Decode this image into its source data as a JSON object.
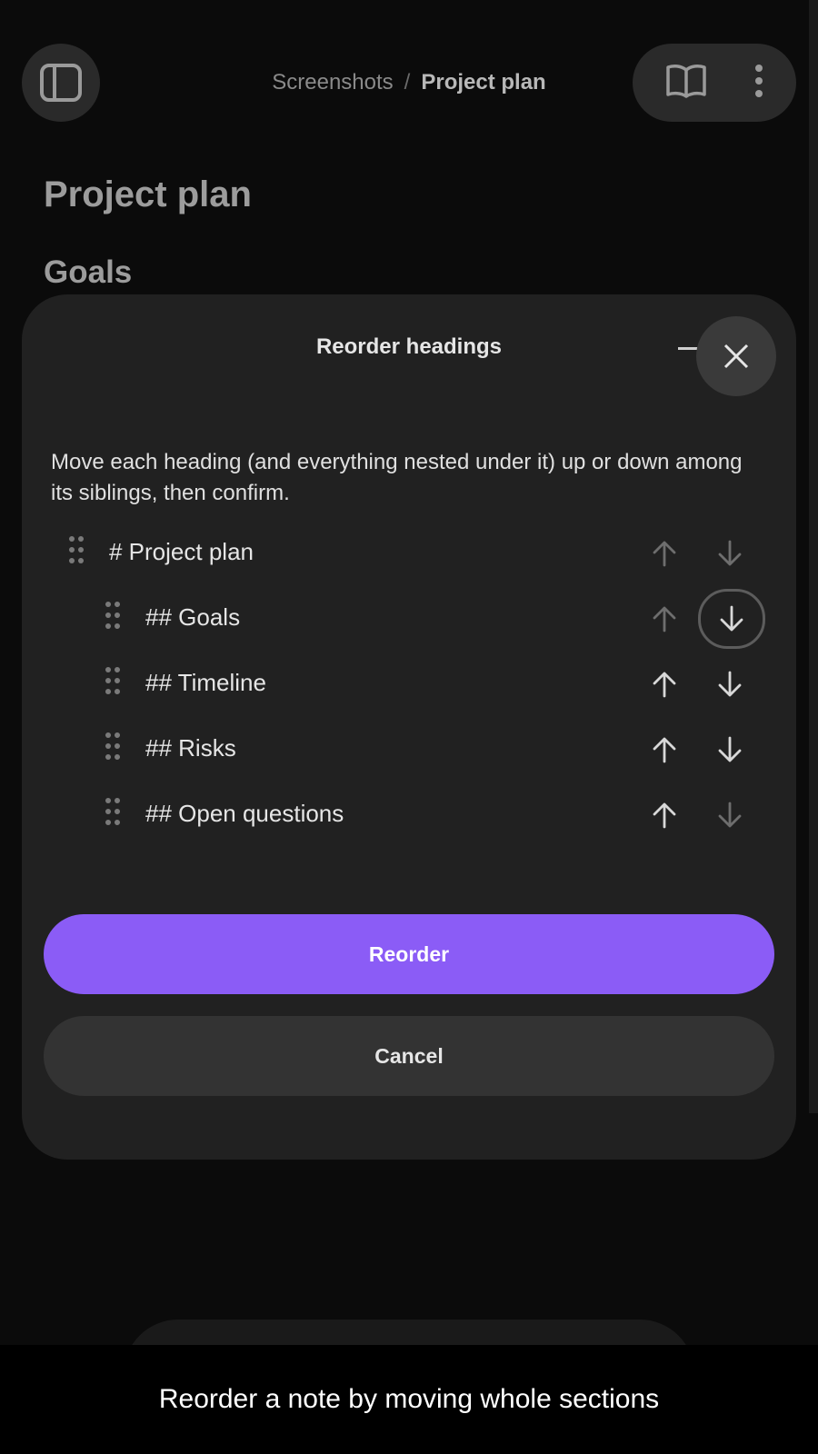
{
  "header": {
    "breadcrumb_root": "Screenshots",
    "breadcrumb_separator": "/",
    "breadcrumb_current": "Project plan"
  },
  "note": {
    "title": "Project plan",
    "first_heading": "Goals"
  },
  "dialog": {
    "title": "Reorder headings",
    "description": "Move each heading (and everything nested under it) up or down among its siblings, then confirm.",
    "headings": [
      {
        "label": "# Project plan",
        "level": 1,
        "up_enabled": false,
        "down_enabled": false
      },
      {
        "label": "## Goals",
        "level": 2,
        "up_enabled": false,
        "down_enabled": true,
        "down_focused": true
      },
      {
        "label": "## Timeline",
        "level": 2,
        "up_enabled": true,
        "down_enabled": true
      },
      {
        "label": "## Risks",
        "level": 2,
        "up_enabled": true,
        "down_enabled": true
      },
      {
        "label": "## Open questions",
        "level": 2,
        "up_enabled": true,
        "down_enabled": false
      }
    ],
    "primary_label": "Reorder",
    "secondary_label": "Cancel"
  },
  "caption": "Reorder a note by moving whole sections",
  "colors": {
    "accent": "#8b5cf6",
    "sheet_bg": "#212121",
    "page_bg": "#0b0b0b"
  }
}
